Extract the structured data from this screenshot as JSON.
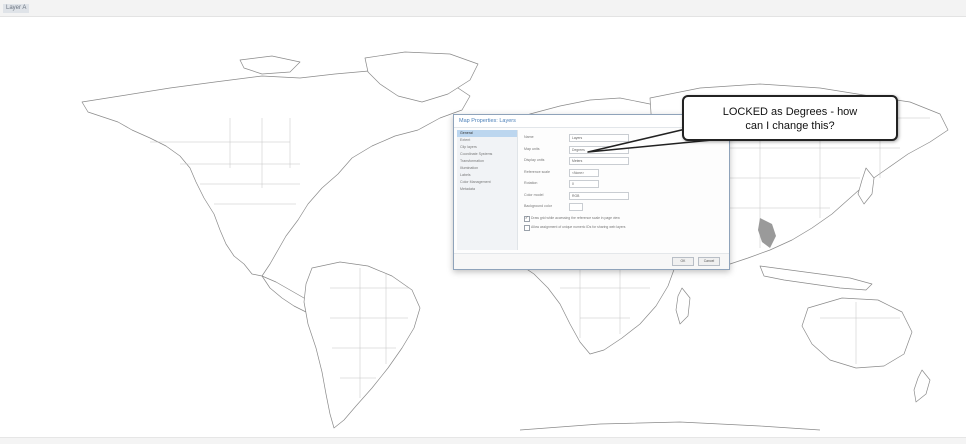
{
  "window": {
    "tab_label": "Layer A",
    "bg_color": "#ffffff"
  },
  "dialog": {
    "title": "Map Properties: Layers",
    "nav_items": [
      "General",
      "Extent",
      "Clip layers",
      "Coordinate Systems",
      "Transformation",
      "Illumination",
      "Labels",
      "Color Management",
      "Metadata"
    ],
    "fields": {
      "name_label": "Name",
      "name_value": "Layers",
      "map_units_label": "Map units",
      "map_units_value": "Degrees",
      "display_units_label": "Display units",
      "display_units_value": "Meters",
      "reference_scale_label": "Reference scale",
      "reference_scale_value": "<None>",
      "rotation_label": "Rotation",
      "rotation_value": "0",
      "color_model_label": "Color model",
      "color_model_value": "RGB",
      "background_label": "Background color",
      "background_value": ""
    },
    "checkboxes": [
      {
        "label": "Allow assignment of unique numeric IDs for sharing web layers",
        "checked": false
      },
      {
        "label": "Draw grid while accessing the reference scale in page view",
        "checked": true
      }
    ],
    "ok_label": "OK",
    "cancel_label": "Cancel"
  },
  "callout": {
    "line1": "LOCKED as Degrees - how",
    "line2": "can I change this?"
  }
}
